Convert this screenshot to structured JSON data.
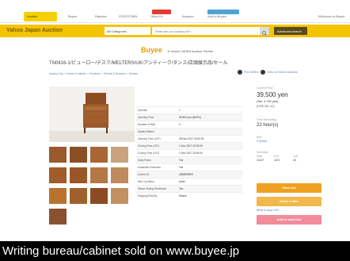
{
  "topnav": {
    "items": [
      "Auction",
      "Buyee",
      "Rakuten",
      "ZOZOTOWN",
      "Other Ec",
      "Amazon",
      "Add to Buyee",
      "Welcome to Buyee"
    ],
    "active": "Auction"
  },
  "ybar": {
    "brand": "Yahoo Japan Auction",
    "category": "All Categories",
    "search_placeholder": "What are you looking for?",
    "advanced_label": "Advanced search"
  },
  "banner": {
    "logo": "Buyee",
    "tagline": "A Yahoo! JAPAN Auction Partner"
  },
  "item": {
    "title": "TN0416-1/ビューロー/デスク/MELTERS/UK/アンティーク/タンス/店頭展示品/セール",
    "breadcrumb": "Auction Top > Home & Interior > Furniture > Chests & Drawers > Drawer",
    "actions": [
      "Find Sellers",
      "View on Yahoo! auctions"
    ]
  },
  "details": [
    {
      "key": "Quantity",
      "value": "1"
    },
    {
      "key": "Opening Price",
      "value": "39,500 yen (Mo/Fri)"
    },
    {
      "key": "Number of Bids",
      "value": "0"
    },
    {
      "key": "Highest Bidder",
      "value": "-"
    },
    {
      "key": "Opening Time (JST)",
      "value": "28 Nov 2017 22:00:00"
    },
    {
      "key": "Closing Time (JST)",
      "value": "1 Dec 2017 22:00:00"
    },
    {
      "key": "Closing Time (JST)",
      "value": "1 Dec 2017 22:00:00"
    },
    {
      "key": "Early Finish",
      "value": "Yes"
    },
    {
      "key": "Automatic Extension",
      "value": "Yes"
    },
    {
      "key": "Auction ID",
      "value": "a288899909"
    },
    {
      "key": "Item Condition",
      "value": "Used"
    },
    {
      "key": "Winner Rating Restriction",
      "value": "Yes"
    },
    {
      "key": "Shipping Paid By",
      "value": "Winner"
    }
  ],
  "sidebar": {
    "current_price_label": "Current Price",
    "current_price": "39,500 yen",
    "tax_note": "(Tax: 4,740 yen)",
    "usd": "(US$ 351.10)",
    "time_left_label": "Time Remaining",
    "time_left": "22 hour(s)",
    "bids_label": "Bids",
    "bids": "0 (Bids)",
    "schedule_label": "Schedule",
    "schedule_cols": [
      "Start",
      "End",
      "Left"
    ],
    "schedule_vals": [
      "11/27",
      "12/1",
      "22"
    ],
    "place_bid": "Place bid",
    "snipe": "Snipe it later",
    "what_snipe": "What is snipe bid?",
    "watchlist": "Add to watchlist"
  },
  "caption": "Writing bureau/cabinet sold on www.buyee.jp",
  "colors": {
    "yahoo_yellow": "#f5c400",
    "accent_orange": "#f0a020",
    "watch_pink": "#f28b9a",
    "wood_brown": "#9a5a2c"
  }
}
